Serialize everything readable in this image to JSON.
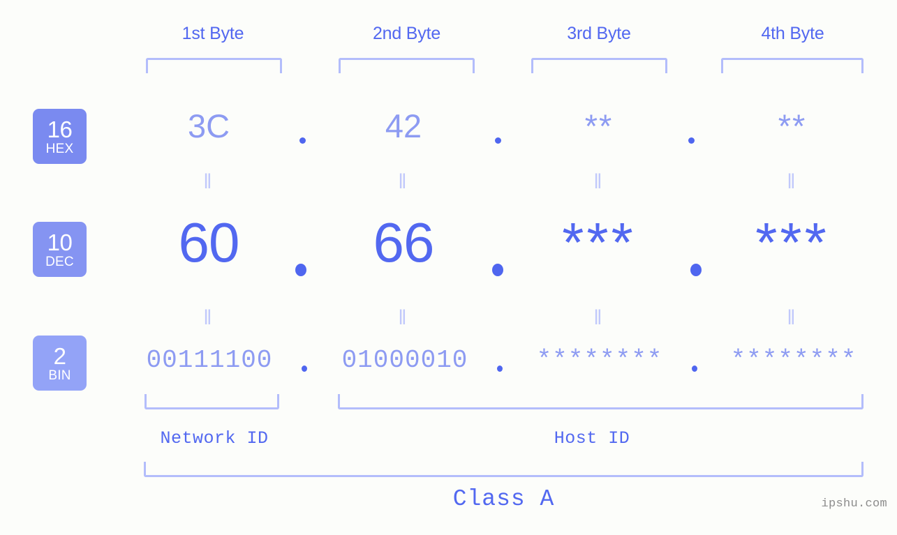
{
  "meta": {
    "background": "#fcfdfa",
    "accent": "#5268f0",
    "accent_light": "#8d9bf2",
    "bracket_color": "#b3bdfb",
    "watermark": "ipshu.com"
  },
  "byte_headers": [
    {
      "label": "1st Byte"
    },
    {
      "label": "2nd Byte"
    },
    {
      "label": "3rd Byte"
    },
    {
      "label": "4th Byte"
    }
  ],
  "bases": [
    {
      "number": "16",
      "name": "HEX",
      "color": "#7a8af0"
    },
    {
      "number": "10",
      "name": "DEC",
      "color": "#8594f2"
    },
    {
      "number": "2",
      "name": "BIN",
      "color": "#93a3f7"
    }
  ],
  "rows": {
    "hex": {
      "values": [
        "3C",
        "42",
        "**",
        "**"
      ]
    },
    "dec": {
      "values": [
        "60",
        "66",
        "***",
        "***"
      ]
    },
    "bin": {
      "values": [
        "00111100",
        "01000010",
        "********",
        "********"
      ]
    }
  },
  "separators": {
    "dot": ".",
    "equals": "‖"
  },
  "footer": {
    "network_id": "Network ID",
    "host_id": "Host ID",
    "class": "Class A"
  }
}
